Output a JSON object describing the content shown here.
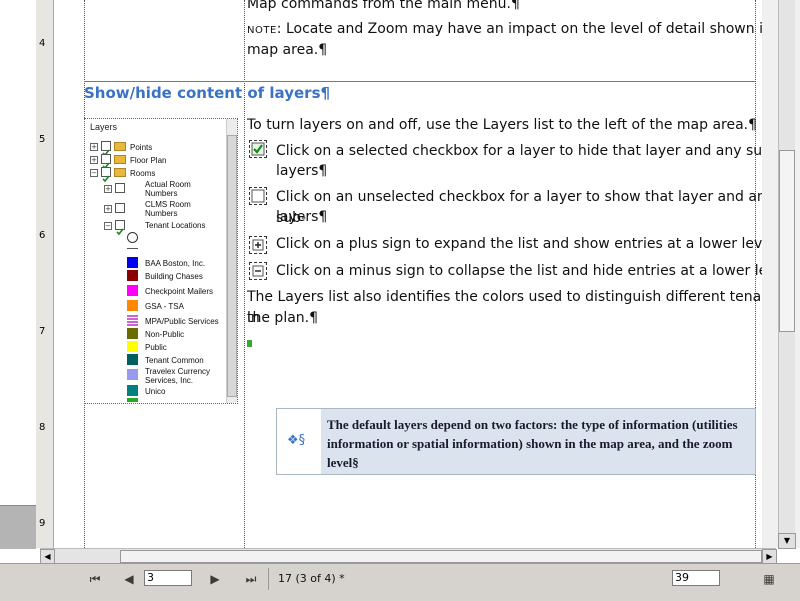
{
  "ruler": {
    "marks": [
      "4",
      "5",
      "6",
      "7",
      "8",
      "9"
    ]
  },
  "doc": {
    "line_top": "Map commands from the main menu.¶",
    "note_label": "NOTE",
    "note_text": ": Locate and Zoom may have an impact on the level of detail shown in the",
    "note_text2": "map area.¶",
    "heading": "Show/hide content of layers¶",
    "intro": "To turn layers on and off, use the Layers list to the left of the map area.¶",
    "bullets": [
      {
        "line1": "Click on a selected checkbox for a layer to hide that layer and any sub-",
        "line2": "layers¶",
        "icon": "checked-checkbox-icon"
      },
      {
        "line1": "Click on an unselected checkbox for a layer to show that layer and any sub-",
        "line2": "layers¶",
        "icon": "unchecked-checkbox-icon"
      },
      {
        "line1": "Click on a plus sign to expand the list and show entries at a lower level¶",
        "icon": "plus-icon"
      },
      {
        "line1": "Click on a minus sign to collapse the list and hide entries at a lower level¶",
        "icon": "minus-icon"
      }
    ],
    "outro1": "The Layers list also identifies the colors used to distinguish different tenants in",
    "outro2": "the plan.¶",
    "callout": "The default layers depend on two factors: the type of information (utilities information or spatial information) shown in the map area, and the zoom level§",
    "callout_marker": "❖§"
  },
  "layers_panel": {
    "title": "Layers",
    "items": [
      {
        "label": "Points",
        "expander": "+",
        "checked": true
      },
      {
        "label": "Floor Plan",
        "expander": "+",
        "checked": true
      },
      {
        "label": "Rooms",
        "expander": "−",
        "checked": true
      },
      {
        "label": "Actual Room",
        "label2": "Numbers",
        "expander": "+",
        "checked": false
      },
      {
        "label": "CLMS Room",
        "label2": "Numbers",
        "expander": "+",
        "checked": false
      },
      {
        "label": "Tenant Locations",
        "expander": "−",
        "checked": true
      }
    ],
    "legend": [
      {
        "label": "BAA Boston, Inc.",
        "color": "#0000ee"
      },
      {
        "label": "Building Chases",
        "color": "#8b0000"
      },
      {
        "label": "Checkpoint Mailers",
        "color": "#ff00ff"
      },
      {
        "label": "GSA - TSA",
        "color": "#ff8800"
      },
      {
        "label": "MPA/Public Services",
        "color": "#cc66cc"
      },
      {
        "label": "Non-Public",
        "color": "#6b6b00"
      },
      {
        "label": "Public",
        "color": "#ffff00"
      },
      {
        "label": "Tenant Common",
        "color": "#006060"
      },
      {
        "label": "Travelex Currency",
        "label2": "Services, Inc.",
        "color": "#9999ee"
      },
      {
        "label": "Unico",
        "color": "#008080"
      }
    ]
  },
  "statusbar": {
    "page_input": "3",
    "page_status": "17 (3 of 4) *",
    "zoom_input": "39"
  }
}
